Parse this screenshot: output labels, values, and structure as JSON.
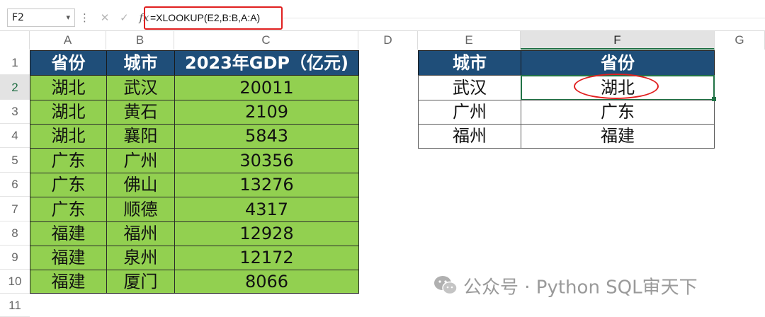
{
  "name_box": "F2",
  "formula": "=XLOOKUP(E2,B:B,A:A)",
  "columns": [
    "A",
    "B",
    "C",
    "D",
    "E",
    "F",
    "G"
  ],
  "rows": [
    "1",
    "2",
    "3",
    "4",
    "5",
    "6",
    "7",
    "8",
    "9",
    "10",
    "11"
  ],
  "table1": {
    "headers": [
      "省份",
      "城市",
      "2023年GDP（亿元)"
    ],
    "rows": [
      [
        "湖北",
        "武汉",
        "20011"
      ],
      [
        "湖北",
        "黄石",
        "2109"
      ],
      [
        "湖北",
        "襄阳",
        "5843"
      ],
      [
        "广东",
        "广州",
        "30356"
      ],
      [
        "广东",
        "佛山",
        "13276"
      ],
      [
        "广东",
        "顺德",
        "4317"
      ],
      [
        "福建",
        "福州",
        "12928"
      ],
      [
        "福建",
        "泉州",
        "12172"
      ],
      [
        "福建",
        "厦门",
        "8066"
      ]
    ]
  },
  "table2": {
    "headers": [
      "城市",
      "省份"
    ],
    "rows": [
      [
        "武汉",
        "湖北"
      ],
      [
        "广州",
        "广东"
      ],
      [
        "福州",
        "福建"
      ]
    ]
  },
  "watermark": "公众号 · Python SQL审天下",
  "colors": {
    "header_fill": "#1f4e79",
    "data_fill": "#92d050",
    "highlight": "#e02020",
    "selection": "#217346"
  }
}
